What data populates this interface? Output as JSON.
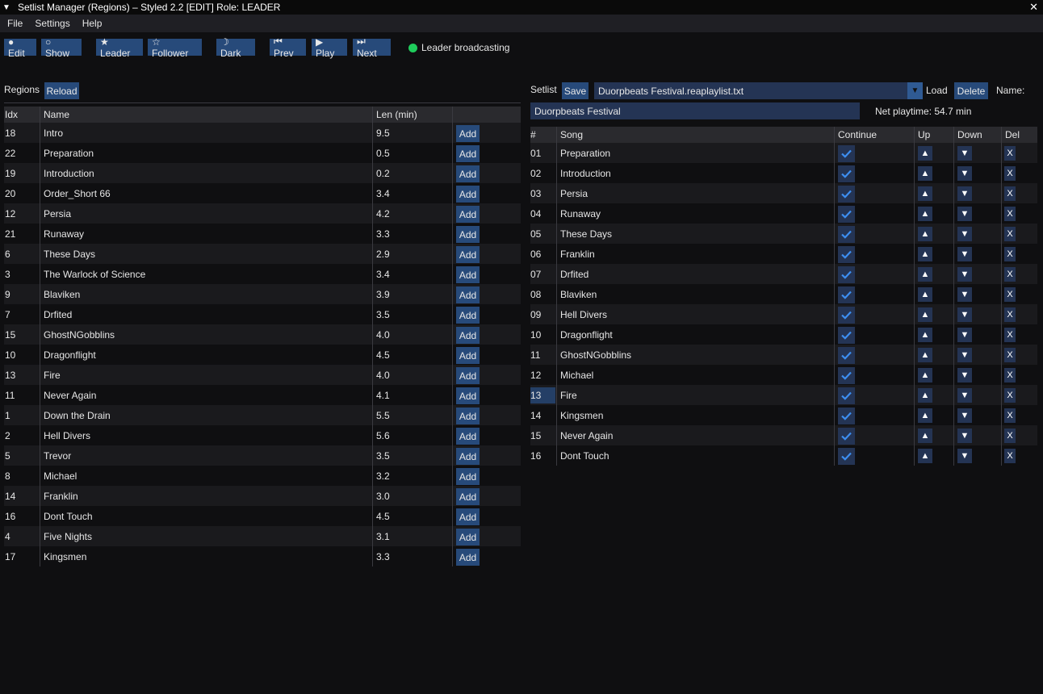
{
  "window": {
    "title": "Setlist Manager (Regions) – Styled  2.2  [EDIT]  Role: LEADER",
    "collapse_glyph": "▼",
    "close_glyph": "✕"
  },
  "menu": [
    "File",
    "Settings",
    "Help"
  ],
  "toolbar": {
    "edit": "● Edit",
    "show": "○ Show",
    "leader": "★ Leader",
    "follower": "☆ Follower",
    "dark": "☽ Dark",
    "prev": "⏮ Prev",
    "play": "▶ Play",
    "next": "⏭ Next",
    "status": "Leader broadcasting",
    "status_color": "#1fcc5c"
  },
  "regions": {
    "label": "Regions",
    "reload": "Reload",
    "headers": {
      "idx": "Idx",
      "name": "Name",
      "len": "Len (min)"
    },
    "add_label": "Add",
    "rows": [
      {
        "idx": "18",
        "name": "Intro",
        "len": "9.5"
      },
      {
        "idx": "22",
        "name": "Preparation",
        "len": "0.5"
      },
      {
        "idx": "19",
        "name": "Introduction",
        "len": "0.2"
      },
      {
        "idx": "20",
        "name": "Order_Short 66",
        "len": "3.4"
      },
      {
        "idx": "12",
        "name": "Persia",
        "len": "4.2"
      },
      {
        "idx": "21",
        "name": "Runaway",
        "len": "3.3"
      },
      {
        "idx": "6",
        "name": "These Days",
        "len": "2.9"
      },
      {
        "idx": "3",
        "name": "The Warlock of Science",
        "len": "3.4"
      },
      {
        "idx": "9",
        "name": "Blaviken",
        "len": "3.9"
      },
      {
        "idx": "7",
        "name": "Drfited",
        "len": "3.5"
      },
      {
        "idx": "15",
        "name": "GhostNGobblins",
        "len": "4.0"
      },
      {
        "idx": "10",
        "name": "Dragonflight",
        "len": "4.5"
      },
      {
        "idx": "13",
        "name": "Fire",
        "len": "4.0"
      },
      {
        "idx": "11",
        "name": "Never Again",
        "len": "4.1"
      },
      {
        "idx": "1",
        "name": "Down the Drain",
        "len": "5.5"
      },
      {
        "idx": "2",
        "name": "Hell Divers",
        "len": "5.6"
      },
      {
        "idx": "5",
        "name": "Trevor",
        "len": "3.5"
      },
      {
        "idx": "8",
        "name": "Michael",
        "len": "3.2"
      },
      {
        "idx": "14",
        "name": "Franklin",
        "len": "3.0"
      },
      {
        "idx": "16",
        "name": "Dont Touch",
        "len": "4.5"
      },
      {
        "idx": "4",
        "name": "Five Nights",
        "len": "3.1"
      },
      {
        "idx": "17",
        "name": "Kingsmen",
        "len": "3.3"
      }
    ]
  },
  "setlist": {
    "label": "Setlist",
    "save": "Save",
    "file": "Duorpbeats Festival.reaplaylist.txt",
    "combo_arrow": "▼",
    "load": "Load",
    "delete": "Delete",
    "name_label": "Name:",
    "name_value": "Duorpbeats Festival",
    "net_playtime": "Net playtime: 54.7 min",
    "headers": {
      "num": "#",
      "song": "Song",
      "continue": "Continue",
      "up": "Up",
      "down": "Down",
      "del": "Del"
    },
    "up_glyph": "▲",
    "down_glyph": "▼",
    "del_glyph": "X",
    "selected_row": 12,
    "rows": [
      {
        "num": "01",
        "song": "Preparation",
        "continue": true
      },
      {
        "num": "02",
        "song": "Introduction",
        "continue": true
      },
      {
        "num": "03",
        "song": "Persia",
        "continue": true
      },
      {
        "num": "04",
        "song": "Runaway",
        "continue": true
      },
      {
        "num": "05",
        "song": "These Days",
        "continue": true
      },
      {
        "num": "06",
        "song": "Franklin",
        "continue": true
      },
      {
        "num": "07",
        "song": "Drfited",
        "continue": true
      },
      {
        "num": "08",
        "song": "Blaviken",
        "continue": true
      },
      {
        "num": "09",
        "song": "Hell Divers",
        "continue": true
      },
      {
        "num": "10",
        "song": "Dragonflight",
        "continue": true
      },
      {
        "num": "11",
        "song": "GhostNGobblins",
        "continue": true
      },
      {
        "num": "12",
        "song": "Michael",
        "continue": true
      },
      {
        "num": "13",
        "song": "Fire",
        "continue": true
      },
      {
        "num": "14",
        "song": "Kingsmen",
        "continue": true
      },
      {
        "num": "15",
        "song": "Never Again",
        "continue": true
      },
      {
        "num": "16",
        "song": "Dont Touch",
        "continue": true
      }
    ]
  }
}
